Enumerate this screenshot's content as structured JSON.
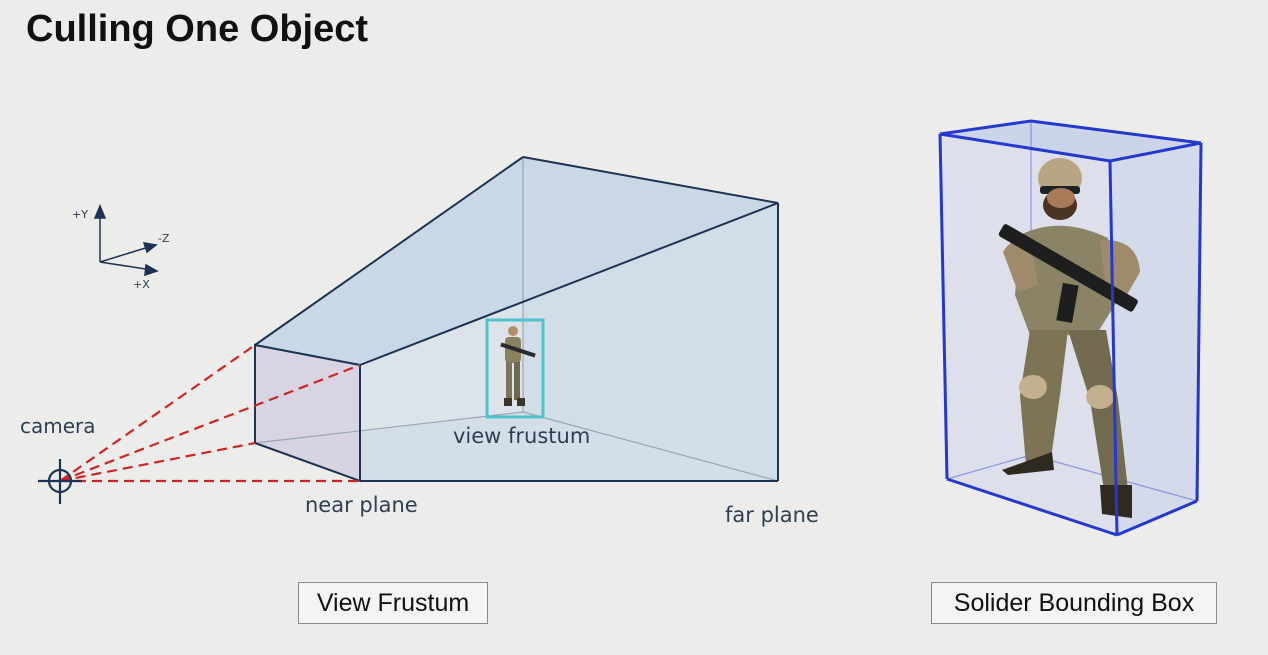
{
  "title": "Culling One Object",
  "axes": {
    "y": "+Y",
    "z": "-Z",
    "x": "+X"
  },
  "labels": {
    "camera": "camera",
    "view_frustum": "view frustum",
    "near_plane": "near plane",
    "far_plane": "far plane"
  },
  "captions": {
    "left": "View Frustum",
    "right": "Solider Bounding Box"
  },
  "colors": {
    "frustum_edge": "#1d3352",
    "frustum_fill": "#b9cde0",
    "camera_ray": "#d02525",
    "small_bbox": "#4fc4cc",
    "soldier_bbox": "#2438d0"
  }
}
